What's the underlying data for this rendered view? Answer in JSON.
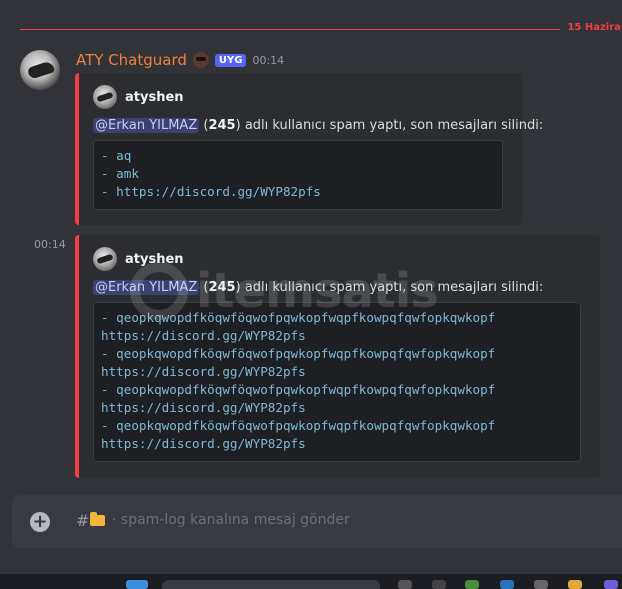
{
  "divider": {
    "date": "15 Haziran"
  },
  "message": {
    "username": "ATY Chatguard",
    "tag": "UYG",
    "time": "00:14",
    "second_time": "00:14"
  },
  "embeds": [
    {
      "author": "atyshen",
      "mention": "@Erkan YILMAZ",
      "count": "245",
      "text": "adlı kullanıcı spam yaptı, son mesajları silindi:",
      "lines": [
        "- aq",
        "- amk",
        "- https://discord.gg/WYP82pfs"
      ]
    },
    {
      "author": "atyshen",
      "mention": "@Erkan YILMAZ",
      "count": "245",
      "text": "adlı kullanıcı spam yaptı, son mesajları silindi:",
      "lines": [
        "- qeopkqwopdfköqwföqwofpqwkopfwqpfkowpqfqwfopkqwkopf",
        "https://discord.gg/WYP82pfs",
        "- qeopkqwopdfköqwföqwofpqwkopfwqpfkowpqfqwfopkqwkopf",
        "https://discord.gg/WYP82pfs",
        "- qeopkqwopdfköqwföqwofpqwkopfwqpfkowpqfqwfopkqwkopf",
        "https://discord.gg/WYP82pfs",
        "- qeopkqwopdfköqwföqwofpqwkopfwqpfkowpqfqwfopkqwkopf",
        "https://discord.gg/WYP82pfs"
      ]
    }
  ],
  "watermark": "itemsatis",
  "composer": {
    "hash": "#",
    "placeholder": "· spam-log kanalına mesaj gönder"
  },
  "colors": {
    "accent": "#5865f2",
    "danger": "#f23f43",
    "username": "#f0813a"
  }
}
